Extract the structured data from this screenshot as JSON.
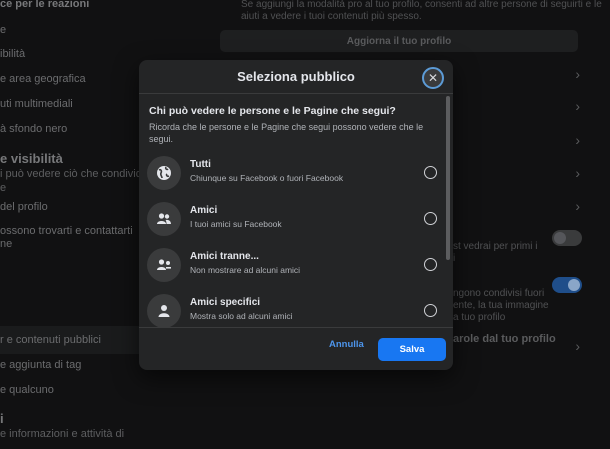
{
  "background": {
    "sidebar": {
      "items": [
        "ce per le reazioni",
        "e",
        "ibilità",
        "e area geografica",
        "uti multimediali",
        "à sfondo nero",
        "e visibilità",
        "i può vedere ciò che condividi",
        "e",
        "del profilo",
        "ossono trovarti e contattarti",
        "ne",
        "r e contenuti pubblici",
        "e aggiunta di tag",
        "e qualcuno",
        "i",
        "e informazioni e attività di"
      ]
    },
    "main": {
      "intro_line1": "Se aggiungi la modalità pro al tuo profilo, consenti ad altre persone di seguirti e le",
      "intro_line2": "aiuti a vedere i tuoi contenuti più spesso.",
      "update_profile_button": "Aggiorna il tuo profilo",
      "frag1": "st vedrai per primi i",
      "frag2": "i",
      "frag3": "ngono condivisi fuori",
      "frag4": "ente, la tua immagine",
      "frag5": "a tuo profilo",
      "frag6": "arole dal tuo profilo"
    }
  },
  "dialog": {
    "title": "Seleziona pubblico",
    "close_icon": "close-icon",
    "question": "Chi può vedere le persone e le Pagine che segui?",
    "description": "Ricorda che le persone e le Pagine che segui possono vedere che le segui.",
    "options": [
      {
        "label": "Tutti",
        "sub": "Chiunque su Facebook o fuori Facebook",
        "icon": "globe-icon"
      },
      {
        "label": "Amici",
        "sub": "I tuoi amici su Facebook",
        "icon": "friends-icon"
      },
      {
        "label": "Amici tranne...",
        "sub": "Non mostrare ad alcuni amici",
        "icon": "friends-except-icon"
      },
      {
        "label": "Amici specifici",
        "sub": "Mostra solo ad alcuni amici",
        "icon": "person-icon"
      }
    ],
    "cancel_label": "Annulla",
    "save_label": "Salva"
  },
  "colors": {
    "accent": "#1877f2",
    "link": "#4d95ec",
    "dialog_bg": "#242526"
  }
}
